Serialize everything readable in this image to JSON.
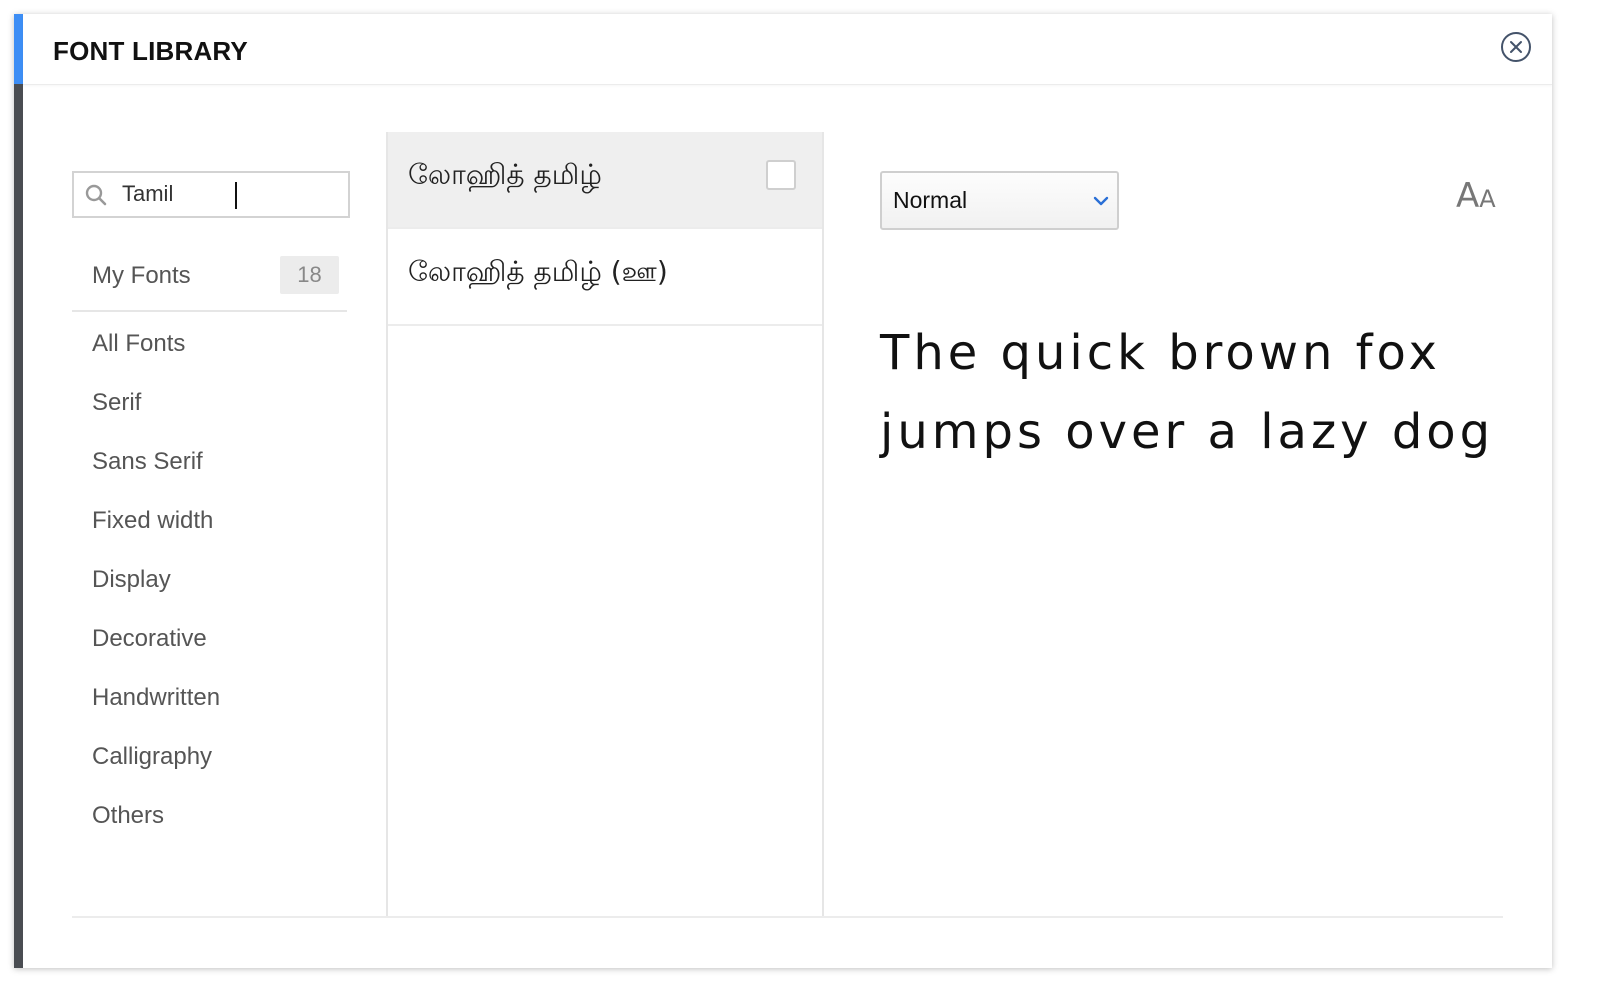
{
  "modal": {
    "title": "FONT LIBRARY",
    "accent_color": "#3d8ef5",
    "close_icon": "close-circle-icon"
  },
  "search": {
    "value": "Tamil",
    "icon": "search-icon"
  },
  "sidebar": {
    "my_fonts": {
      "label": "My Fonts",
      "count": "18"
    },
    "categories": [
      {
        "label": "All Fonts"
      },
      {
        "label": "Serif"
      },
      {
        "label": "Sans Serif"
      },
      {
        "label": "Fixed width"
      },
      {
        "label": "Display"
      },
      {
        "label": "Decorative"
      },
      {
        "label": "Handwritten"
      },
      {
        "label": "Calligraphy"
      },
      {
        "label": "Others"
      }
    ]
  },
  "font_list": {
    "items": [
      {
        "label": "லோஹித் தமிழ்",
        "selected": true,
        "checked": false
      },
      {
        "label": "லோஹித் தமிழ் (ஊ)",
        "selected": false,
        "checked": false
      }
    ]
  },
  "preview": {
    "weight": "Normal",
    "size_toggle_big": "A",
    "size_toggle_small": "A",
    "line1": "The quick brown fox",
    "line2": "jumps over a lazy dog"
  }
}
